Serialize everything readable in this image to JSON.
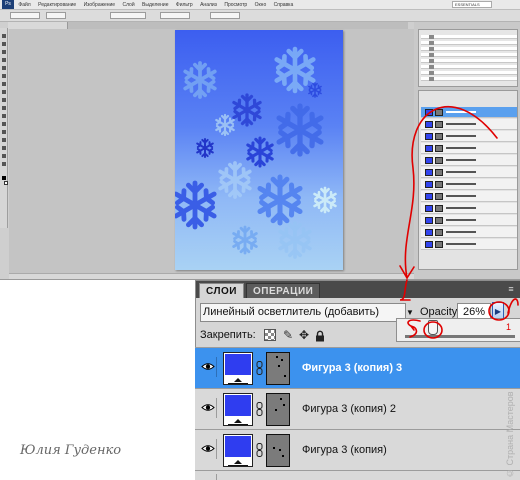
{
  "photoshop": {
    "menu": [
      "Файл",
      "Редактирование",
      "Изображение",
      "Слой",
      "Выделение",
      "Фильтр",
      "Анализ",
      "Просмотр",
      "Окно",
      "Справка"
    ],
    "workspace": "ESSENTIALS"
  },
  "panel": {
    "tabs": [
      "СЛОИ",
      "ОПЕРАЦИИ"
    ],
    "menu_icon": "≡",
    "blend_mode": "Линейный осветлитель (добавить)",
    "opacity_label": "Opacity:",
    "opacity_value": "26%",
    "opacity_percent": 26,
    "lock_label": "Закрепить:",
    "layers": [
      {
        "name": "Фигура 3 (копия) 3",
        "selected": true
      },
      {
        "name": "Фигура 3 (копия) 2",
        "selected": false
      },
      {
        "name": "Фигура 3 (копия)",
        "selected": false
      }
    ]
  },
  "icons": {
    "eye": "eye-icon",
    "chain": "link-icon",
    "lock_all": "padlock-icon",
    "lock_position": "move-arrows-icon",
    "lock_pixels": "brush-icon",
    "lock_transparent": "checker-icon"
  },
  "annotation": {
    "color": "#e00000"
  },
  "signature": "Юлия Гуденко",
  "watermark": "© Страна Мастеров"
}
